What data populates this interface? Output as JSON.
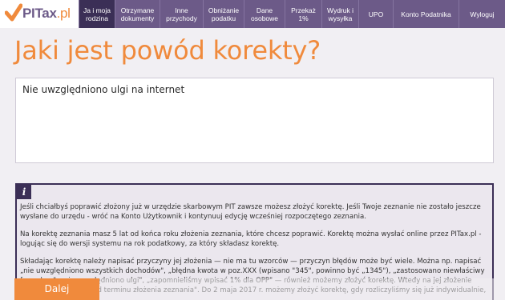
{
  "brand": {
    "name": "PITax",
    "suffix": ".pl",
    "accent_color": "#f08a3c",
    "primary_color": "#6c5a88",
    "dark_color": "#3b2f56"
  },
  "nav": {
    "items": [
      {
        "label": "Ja i moja rodzina",
        "active": true
      },
      {
        "label": "Otrzymane dokumenty",
        "active": false
      },
      {
        "label": "Inne przychody",
        "active": false
      },
      {
        "label": "Obniżanie podatku",
        "active": false
      },
      {
        "label": "Dane osobowe",
        "active": false
      },
      {
        "label": "Przekaż 1%",
        "active": false
      },
      {
        "label": "Wydruk i wysyłka",
        "active": false
      },
      {
        "label": "UPO",
        "active": false
      },
      {
        "label": "Konto Podatnika",
        "active": false
      },
      {
        "label": "Wyloguj",
        "active": false
      }
    ]
  },
  "page": {
    "title": "Jaki jest powód korekty?"
  },
  "reason_field": {
    "value": "Nie uwzględniono ulgi na internet"
  },
  "info": {
    "icon": "info-icon",
    "icon_glyph": "i",
    "paragraphs": [
      "Jeśli chciałbyś poprawić złożony już w urzędzie skarbowym PIT zawsze możesz złożyć korektę. Jeśli Twoje zeznanie nie zostało jeszcze wysłane do urzędu - wróć na Konto Użytkownik i kontynuuj edycję wcześniej rozpoczętego zeznania.",
      "Na korektę zeznania masz 5 lat od końca roku złożenia zeznania, które chcesz poprawić. Korektę można wysłać online przez PITax.pl - logując się do wersji systemu na rok podatkowy, za który składasz korektę.",
      "Składając korektę należy napisać przyczyny jej złożenia — nie ma tu wzorców — przyczyn błędów może być wiele. Można np. napisać „nie uwzględniono wszystkich dochodów\", „błędna kwota w poz.XXX (wpisano \"345\", powinno być „1345\"), „zastosowano niewłaściwy formularz\", „nie uwzględniono ulgi\", „zapomnieliśmy wpisać 1% dla OPP\" — również możemy złożyć korektę. Wtedy na jej złożenie mamy dwa miesiące od terminu złożenia zeznania\". Do 2 maja 2017 r. możemy złożyć korektę, gdy rozliczyliśmy się już indywidualnie, a jednak chcielibyśmy"
    ]
  },
  "actions": {
    "next_label": "Dalej"
  }
}
